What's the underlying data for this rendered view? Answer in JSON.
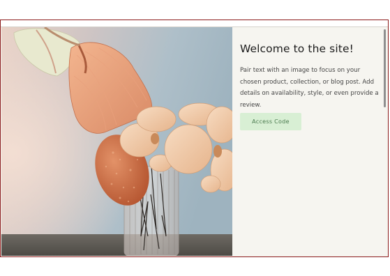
{
  "section": {
    "heading": "Welcome to the site!",
    "body": "Pair text with an image to focus on your chosen product, collection, or blog post. Add details on availability, style, or even provide a review.",
    "button_label": "Access Code"
  },
  "image": {
    "subject": "flower-arrangement-photo"
  },
  "colors": {
    "frame_border": "#8b1a1a",
    "panel_background": "#f6f5f0",
    "button_background": "#d8efd4",
    "button_text": "#4a7a4e"
  }
}
